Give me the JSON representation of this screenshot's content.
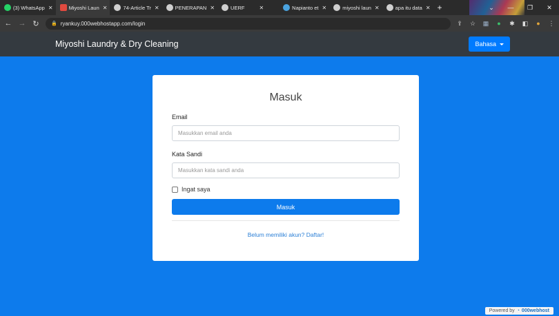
{
  "browser": {
    "tabs": [
      {
        "title": "(3) WhatsApp",
        "favicon_color": "#25d366"
      },
      {
        "title": "Miyoshi Laun",
        "favicon_color": "#e04a3f"
      },
      {
        "title": "74-Article Tr",
        "favicon_color": "#cfcfcf"
      },
      {
        "title": "PENERAPAN",
        "favicon_color": "#cfcfcf"
      },
      {
        "title": "UERF",
        "favicon_color": "#cfcfcf"
      },
      {
        "title": "Napianto et",
        "favicon_color": "#4aa3df"
      },
      {
        "title": "miyoshi laun",
        "favicon_color": "#cfcfcf"
      },
      {
        "title": "apa itu data",
        "favicon_color": "#cfcfcf"
      }
    ],
    "url": "ryankuy.000webhostapp.com/login"
  },
  "navbar": {
    "brand": "Miyoshi Laundry & Dry Cleaning",
    "language_button": "Bahasa"
  },
  "login": {
    "title": "Masuk",
    "email_label": "Email",
    "email_placeholder": "Masukkan email anda",
    "password_label": "Kata Sandi",
    "password_placeholder": "Masukkan kata sandi anda",
    "remember_label": "Ingat saya",
    "submit_label": "Masuk",
    "register_link": "Belum memiliki akun? Daftar!"
  },
  "footer": {
    "powered_text": "Powered by",
    "host_name": "000webhost"
  },
  "colors": {
    "page_bg": "#0d7bec",
    "navbar_bg": "#343a40",
    "primary": "#007bff"
  }
}
